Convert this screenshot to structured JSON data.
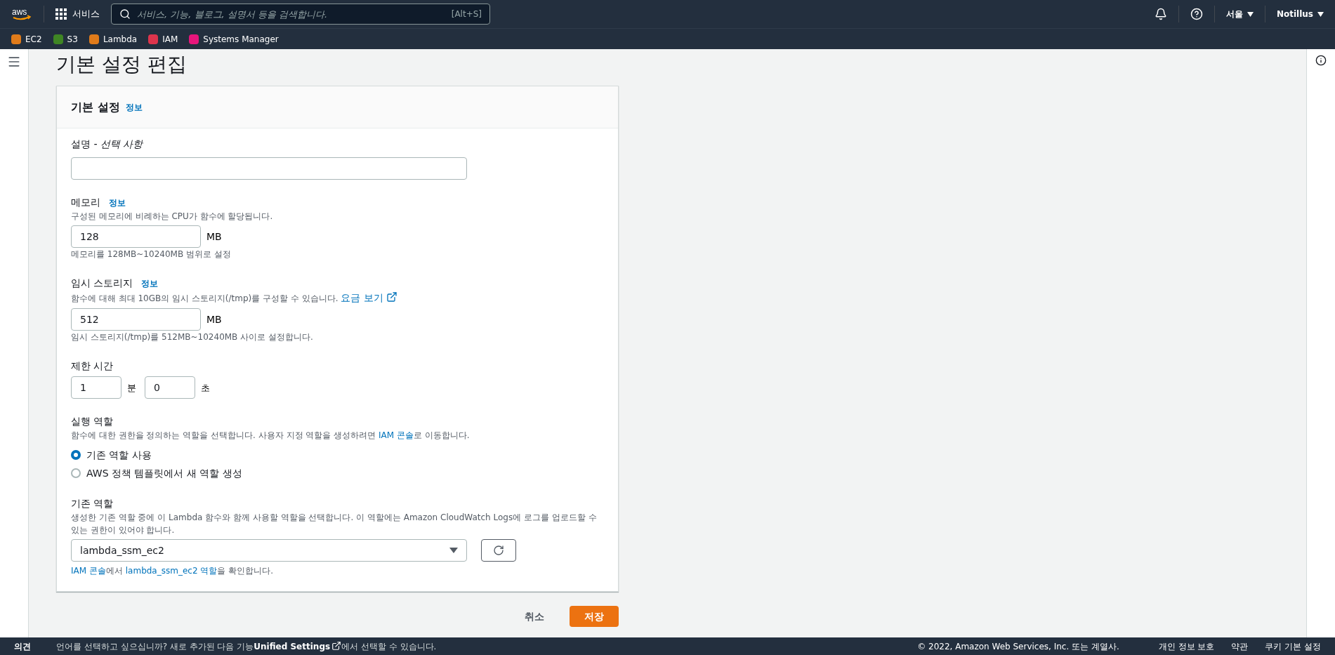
{
  "top_nav": {
    "logo": "aws",
    "services_label": "서비스",
    "search": {
      "placeholder": "서비스, 기능, 블로그, 설명서 등을 검색합니다.",
      "shortcut": "[Alt+S]"
    },
    "region": "서울",
    "user": "Notillus"
  },
  "favorites": [
    {
      "label": "EC2",
      "color": "#e07b1a"
    },
    {
      "label": "S3",
      "color": "#3f8624"
    },
    {
      "label": "Lambda",
      "color": "#e07b1a"
    },
    {
      "label": "IAM",
      "color": "#dd344c"
    },
    {
      "label": "Systems Manager",
      "color": "#e7157b"
    }
  ],
  "page_title": "기본 설정 편집",
  "card": {
    "title": "기본 설정",
    "info_link": "정보",
    "description": {
      "label": "설명",
      "optional": "- 선택 사항"
    },
    "memory": {
      "label": "메모리",
      "info_link": "정보",
      "hint": "구성된 메모리에 비례하는 CPU가 함수에 할당됩니다.",
      "value": "128",
      "unit": "MB",
      "constraint": "메모리를 128MB~10240MB 범위로 설정"
    },
    "storage": {
      "label": "임시 스토리지",
      "info_link": "정보",
      "hint": "함수에 대해 최대 10GB의 임시 스토리지(/tmp)를 구성할 수 있습니다.",
      "pricing_link": "요금 보기",
      "value": "512",
      "unit": "MB",
      "constraint": "임시 스토리지(/tmp)를 512MB~10240MB 사이로 설정합니다."
    },
    "timeout": {
      "label": "제한 시간",
      "minutes": "1",
      "minutes_unit": "분",
      "seconds": "0",
      "seconds_unit": "초"
    },
    "execution_role": {
      "label": "실행 역할",
      "hint": [
        {
          "text": "함수에 대한 권한을 정의하는 역할을 선택합니다. 사용자 지정 역할을 생성하려면 "
        },
        {
          "text": "IAM 콘솔",
          "link": true
        },
        {
          "text": "로 이동합니다."
        }
      ],
      "options": [
        {
          "label": "기존 역할 사용",
          "selected": true
        },
        {
          "label": "AWS 정책 템플릿에서 새 역할 생성",
          "selected": false
        }
      ]
    },
    "existing_role": {
      "label": "기존 역할",
      "hint": "생성한 기존 역할 중에 이 Lambda 함수와 함께 사용할 역할을 선택합니다. 이 역할에는 Amazon CloudWatch Logs에 로그를 업로드할 수 있는 권한이 있어야 합니다.",
      "value": "lambda_ssm_ec2",
      "footnote": [
        {
          "text": "IAM 콘솔",
          "link": true
        },
        {
          "text": "에서 "
        },
        {
          "text": "lambda_ssm_ec2 역할",
          "link": true
        },
        {
          "text": "을 확인합니다."
        }
      ]
    }
  },
  "actions": {
    "cancel": "취소",
    "save": "저장"
  },
  "footer": {
    "feedback": "의견",
    "language_notice": [
      {
        "text": "언어를 선택하고 싶으십니까? 새로 추가된 다음 기능"
      },
      {
        "text": "Unified Settings",
        "link": true
      },
      {
        "text": "에서 선택할 수 있습니다."
      }
    ],
    "copyright": "© 2022, Amazon Web Services, Inc. 또는 계열사.",
    "links": [
      "개인 정보 보호",
      "약관",
      "쿠키 기본 설정"
    ]
  }
}
